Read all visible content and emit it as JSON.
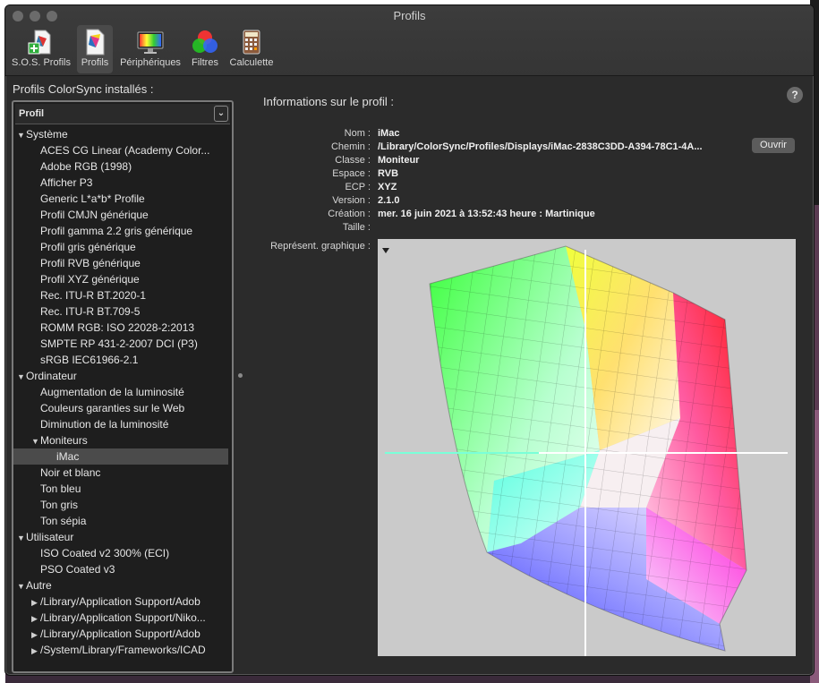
{
  "window": {
    "title": "Profils"
  },
  "toolbar": [
    {
      "label": "S.O.S. Profils",
      "icon": "first-aid-profile-icon"
    },
    {
      "label": "Profils",
      "icon": "profile-document-icon",
      "active": true
    },
    {
      "label": "Périphériques",
      "icon": "display-devices-icon"
    },
    {
      "label": "Filtres",
      "icon": "color-filters-icon"
    },
    {
      "label": "Calculette",
      "icon": "calculator-icon"
    }
  ],
  "left": {
    "title": "Profils ColorSync installés :",
    "header": "Profil",
    "tree": [
      {
        "label": "Système",
        "level": 0,
        "disclosure": "open"
      },
      {
        "label": "ACES CG Linear (Academy Color...",
        "level": 1
      },
      {
        "label": "Adobe RGB (1998)",
        "level": 1
      },
      {
        "label": "Afficher P3",
        "level": 1
      },
      {
        "label": "Generic L*a*b* Profile",
        "level": 1
      },
      {
        "label": "Profil CMJN générique",
        "level": 1
      },
      {
        "label": "Profil gamma 2.2 gris générique",
        "level": 1
      },
      {
        "label": "Profil gris générique",
        "level": 1
      },
      {
        "label": "Profil RVB générique",
        "level": 1
      },
      {
        "label": "Profil XYZ générique",
        "level": 1
      },
      {
        "label": "Rec. ITU-R BT.2020-1",
        "level": 1
      },
      {
        "label": "Rec. ITU-R BT.709-5",
        "level": 1
      },
      {
        "label": "ROMM RGB: ISO 22028-2:2013",
        "level": 1
      },
      {
        "label": "SMPTE RP 431-2-2007 DCI (P3)",
        "level": 1
      },
      {
        "label": "sRGB IEC61966-2.1",
        "level": 1
      },
      {
        "label": "Ordinateur",
        "level": 0,
        "disclosure": "open"
      },
      {
        "label": "Augmentation de la luminosité",
        "level": 1
      },
      {
        "label": "Couleurs garanties sur le Web",
        "level": 1
      },
      {
        "label": "Diminution de la luminosité",
        "level": 1
      },
      {
        "label": "Moniteurs",
        "level": 1,
        "disclosure": "open"
      },
      {
        "label": "iMac",
        "level": 2,
        "selected": true
      },
      {
        "label": "Noir et blanc",
        "level": 1
      },
      {
        "label": "Ton bleu",
        "level": 1
      },
      {
        "label": "Ton gris",
        "level": 1
      },
      {
        "label": "Ton sépia",
        "level": 1
      },
      {
        "label": "Utilisateur",
        "level": 0,
        "disclosure": "open"
      },
      {
        "label": "ISO Coated v2 300% (ECI)",
        "level": 1
      },
      {
        "label": "PSO Coated v3",
        "level": 1
      },
      {
        "label": "Autre",
        "level": 0,
        "disclosure": "open"
      },
      {
        "label": "/Library/Application Support/Adob",
        "level": 1,
        "disclosure": "closed"
      },
      {
        "label": "/Library/Application Support/Niko...",
        "level": 1,
        "disclosure": "closed"
      },
      {
        "label": "/Library/Application Support/Adob",
        "level": 1,
        "disclosure": "closed"
      },
      {
        "label": "/System/Library/Frameworks/ICAD",
        "level": 1,
        "disclosure": "closed"
      }
    ]
  },
  "info": {
    "title": "Informations sur le profil :",
    "help": "?",
    "fields": [
      {
        "label": "Nom :",
        "value": "iMac"
      },
      {
        "label": "Chemin :",
        "value": "/Library/ColorSync/Profiles/Displays/iMac-2838C3DD-A394-78C1-4A..."
      },
      {
        "label": "Classe :",
        "value": "Moniteur"
      },
      {
        "label": "Espace :",
        "value": "RVB"
      },
      {
        "label": "ECP :",
        "value": "XYZ"
      },
      {
        "label": "Version :",
        "value": "2.1.0"
      },
      {
        "label": "Création :",
        "value": "mer. 16 juin 2021 à 13:52:43 heure : Martinique"
      },
      {
        "label": "Taille :",
        "value": ""
      }
    ],
    "open_button": "Ouvrir",
    "graph_label": "Représent. graphique :",
    "graph_menu_icon": "triangle-down-icon"
  }
}
